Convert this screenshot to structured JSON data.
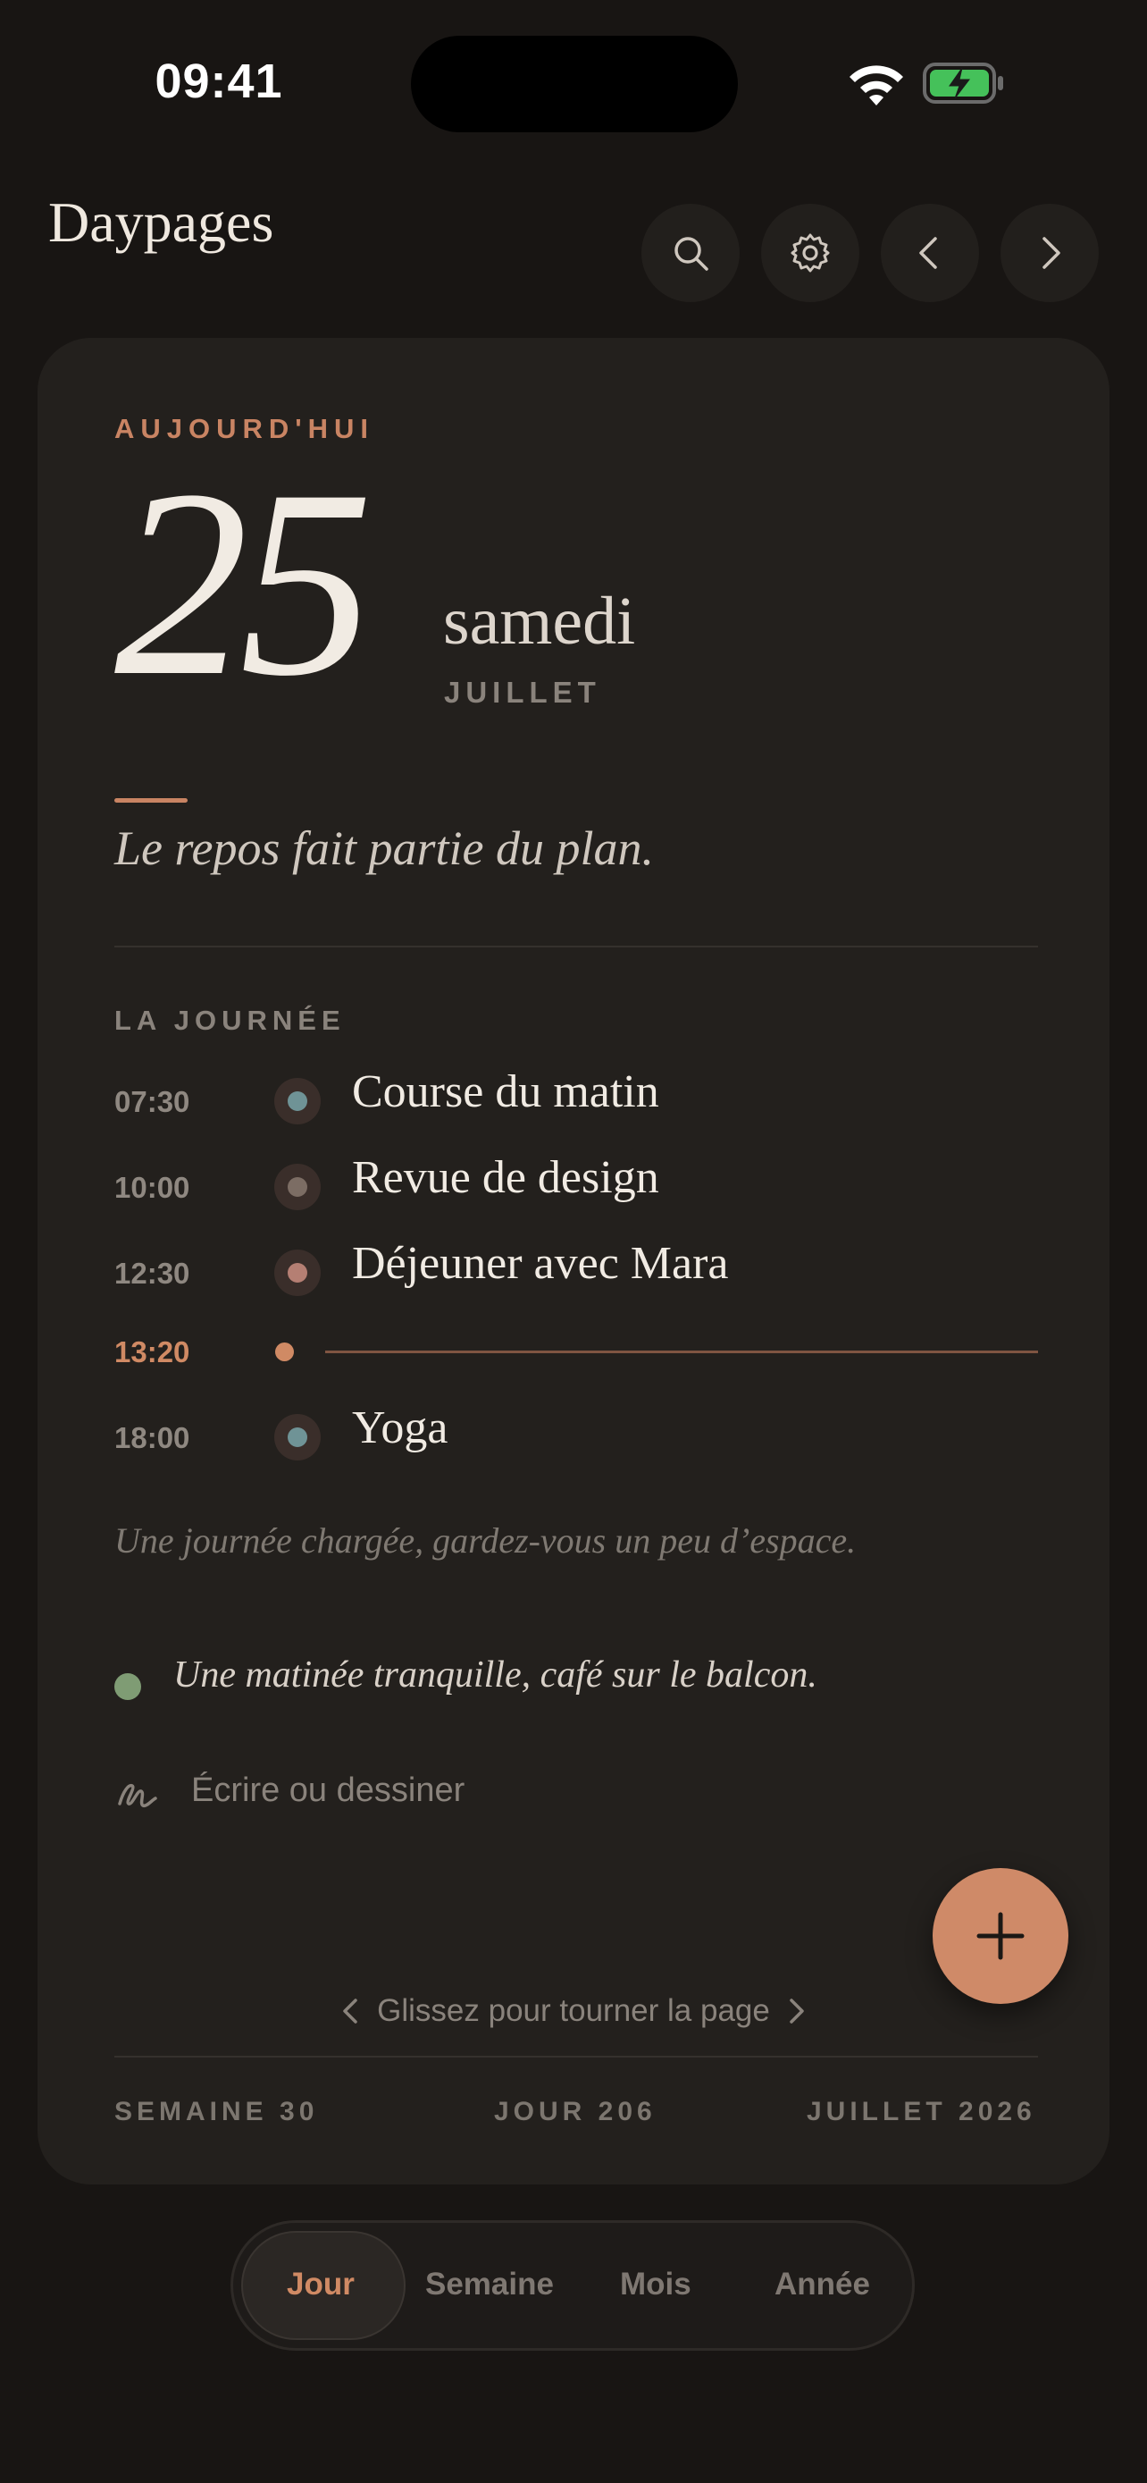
{
  "status_bar": {
    "time": "09:41"
  },
  "header": {
    "title": "Daypages"
  },
  "today": {
    "kicker": "AUJOURD'HUI",
    "day_number": "25",
    "weekday": "samedi",
    "month": "JUILLET",
    "quote": "Le repos fait partie du plan."
  },
  "schedule": {
    "label": "LA JOURNÉE",
    "events": [
      {
        "time": "07:30",
        "title": "Course du matin",
        "color": "#6f9396"
      },
      {
        "time": "10:00",
        "title": "Revue de design",
        "color": "#7c6d64"
      },
      {
        "time": "12:30",
        "title": "Déjeuner avec Mara",
        "color": "#b57f73"
      }
    ],
    "now_time": "13:20",
    "later_events": [
      {
        "time": "18:00",
        "title": "Yoga",
        "color": "#6f9396"
      }
    ],
    "hint": "Une journée chargée, gardez-vous un peu d’espace."
  },
  "note": {
    "text": "Une matinée tranquille, café sur le balcon.",
    "color": "#7f9c74"
  },
  "composer": {
    "placeholder": "Écrire ou dessiner"
  },
  "swipe_hint": "Glissez pour tourner la page",
  "footer": {
    "week": "SEMAINE 30",
    "day": "JOUR 206",
    "month_year": "JUILLET 2026"
  },
  "view_switcher": {
    "items": [
      "Jour",
      "Semaine",
      "Mois",
      "Année"
    ],
    "active": "Jour"
  },
  "colors": {
    "accent": "#cf8a68",
    "background": "#181513",
    "card": "#23201d"
  }
}
